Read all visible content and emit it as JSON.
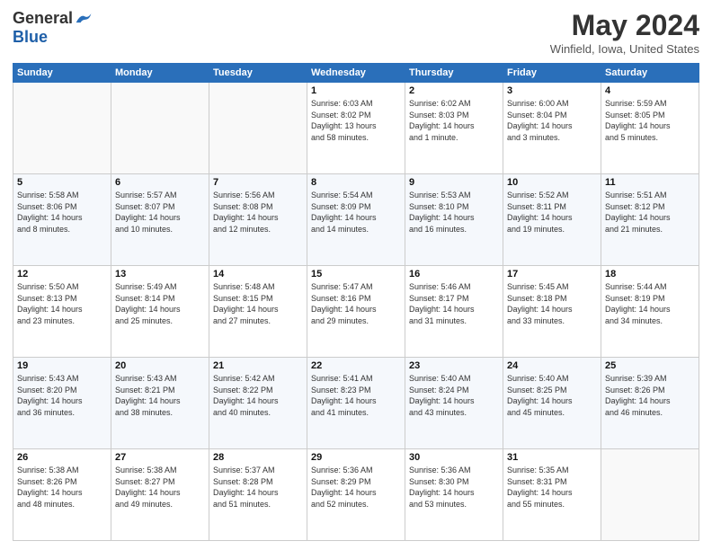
{
  "logo": {
    "general": "General",
    "blue": "Blue"
  },
  "header": {
    "title": "May 2024",
    "location": "Winfield, Iowa, United States"
  },
  "days_of_week": [
    "Sunday",
    "Monday",
    "Tuesday",
    "Wednesday",
    "Thursday",
    "Friday",
    "Saturday"
  ],
  "weeks": [
    [
      {
        "day": "",
        "info": ""
      },
      {
        "day": "",
        "info": ""
      },
      {
        "day": "",
        "info": ""
      },
      {
        "day": "1",
        "info": "Sunrise: 6:03 AM\nSunset: 8:02 PM\nDaylight: 13 hours\nand 58 minutes."
      },
      {
        "day": "2",
        "info": "Sunrise: 6:02 AM\nSunset: 8:03 PM\nDaylight: 14 hours\nand 1 minute."
      },
      {
        "day": "3",
        "info": "Sunrise: 6:00 AM\nSunset: 8:04 PM\nDaylight: 14 hours\nand 3 minutes."
      },
      {
        "day": "4",
        "info": "Sunrise: 5:59 AM\nSunset: 8:05 PM\nDaylight: 14 hours\nand 5 minutes."
      }
    ],
    [
      {
        "day": "5",
        "info": "Sunrise: 5:58 AM\nSunset: 8:06 PM\nDaylight: 14 hours\nand 8 minutes."
      },
      {
        "day": "6",
        "info": "Sunrise: 5:57 AM\nSunset: 8:07 PM\nDaylight: 14 hours\nand 10 minutes."
      },
      {
        "day": "7",
        "info": "Sunrise: 5:56 AM\nSunset: 8:08 PM\nDaylight: 14 hours\nand 12 minutes."
      },
      {
        "day": "8",
        "info": "Sunrise: 5:54 AM\nSunset: 8:09 PM\nDaylight: 14 hours\nand 14 minutes."
      },
      {
        "day": "9",
        "info": "Sunrise: 5:53 AM\nSunset: 8:10 PM\nDaylight: 14 hours\nand 16 minutes."
      },
      {
        "day": "10",
        "info": "Sunrise: 5:52 AM\nSunset: 8:11 PM\nDaylight: 14 hours\nand 19 minutes."
      },
      {
        "day": "11",
        "info": "Sunrise: 5:51 AM\nSunset: 8:12 PM\nDaylight: 14 hours\nand 21 minutes."
      }
    ],
    [
      {
        "day": "12",
        "info": "Sunrise: 5:50 AM\nSunset: 8:13 PM\nDaylight: 14 hours\nand 23 minutes."
      },
      {
        "day": "13",
        "info": "Sunrise: 5:49 AM\nSunset: 8:14 PM\nDaylight: 14 hours\nand 25 minutes."
      },
      {
        "day": "14",
        "info": "Sunrise: 5:48 AM\nSunset: 8:15 PM\nDaylight: 14 hours\nand 27 minutes."
      },
      {
        "day": "15",
        "info": "Sunrise: 5:47 AM\nSunset: 8:16 PM\nDaylight: 14 hours\nand 29 minutes."
      },
      {
        "day": "16",
        "info": "Sunrise: 5:46 AM\nSunset: 8:17 PM\nDaylight: 14 hours\nand 31 minutes."
      },
      {
        "day": "17",
        "info": "Sunrise: 5:45 AM\nSunset: 8:18 PM\nDaylight: 14 hours\nand 33 minutes."
      },
      {
        "day": "18",
        "info": "Sunrise: 5:44 AM\nSunset: 8:19 PM\nDaylight: 14 hours\nand 34 minutes."
      }
    ],
    [
      {
        "day": "19",
        "info": "Sunrise: 5:43 AM\nSunset: 8:20 PM\nDaylight: 14 hours\nand 36 minutes."
      },
      {
        "day": "20",
        "info": "Sunrise: 5:43 AM\nSunset: 8:21 PM\nDaylight: 14 hours\nand 38 minutes."
      },
      {
        "day": "21",
        "info": "Sunrise: 5:42 AM\nSunset: 8:22 PM\nDaylight: 14 hours\nand 40 minutes."
      },
      {
        "day": "22",
        "info": "Sunrise: 5:41 AM\nSunset: 8:23 PM\nDaylight: 14 hours\nand 41 minutes."
      },
      {
        "day": "23",
        "info": "Sunrise: 5:40 AM\nSunset: 8:24 PM\nDaylight: 14 hours\nand 43 minutes."
      },
      {
        "day": "24",
        "info": "Sunrise: 5:40 AM\nSunset: 8:25 PM\nDaylight: 14 hours\nand 45 minutes."
      },
      {
        "day": "25",
        "info": "Sunrise: 5:39 AM\nSunset: 8:26 PM\nDaylight: 14 hours\nand 46 minutes."
      }
    ],
    [
      {
        "day": "26",
        "info": "Sunrise: 5:38 AM\nSunset: 8:26 PM\nDaylight: 14 hours\nand 48 minutes."
      },
      {
        "day": "27",
        "info": "Sunrise: 5:38 AM\nSunset: 8:27 PM\nDaylight: 14 hours\nand 49 minutes."
      },
      {
        "day": "28",
        "info": "Sunrise: 5:37 AM\nSunset: 8:28 PM\nDaylight: 14 hours\nand 51 minutes."
      },
      {
        "day": "29",
        "info": "Sunrise: 5:36 AM\nSunset: 8:29 PM\nDaylight: 14 hours\nand 52 minutes."
      },
      {
        "day": "30",
        "info": "Sunrise: 5:36 AM\nSunset: 8:30 PM\nDaylight: 14 hours\nand 53 minutes."
      },
      {
        "day": "31",
        "info": "Sunrise: 5:35 AM\nSunset: 8:31 PM\nDaylight: 14 hours\nand 55 minutes."
      },
      {
        "day": "",
        "info": ""
      }
    ]
  ]
}
